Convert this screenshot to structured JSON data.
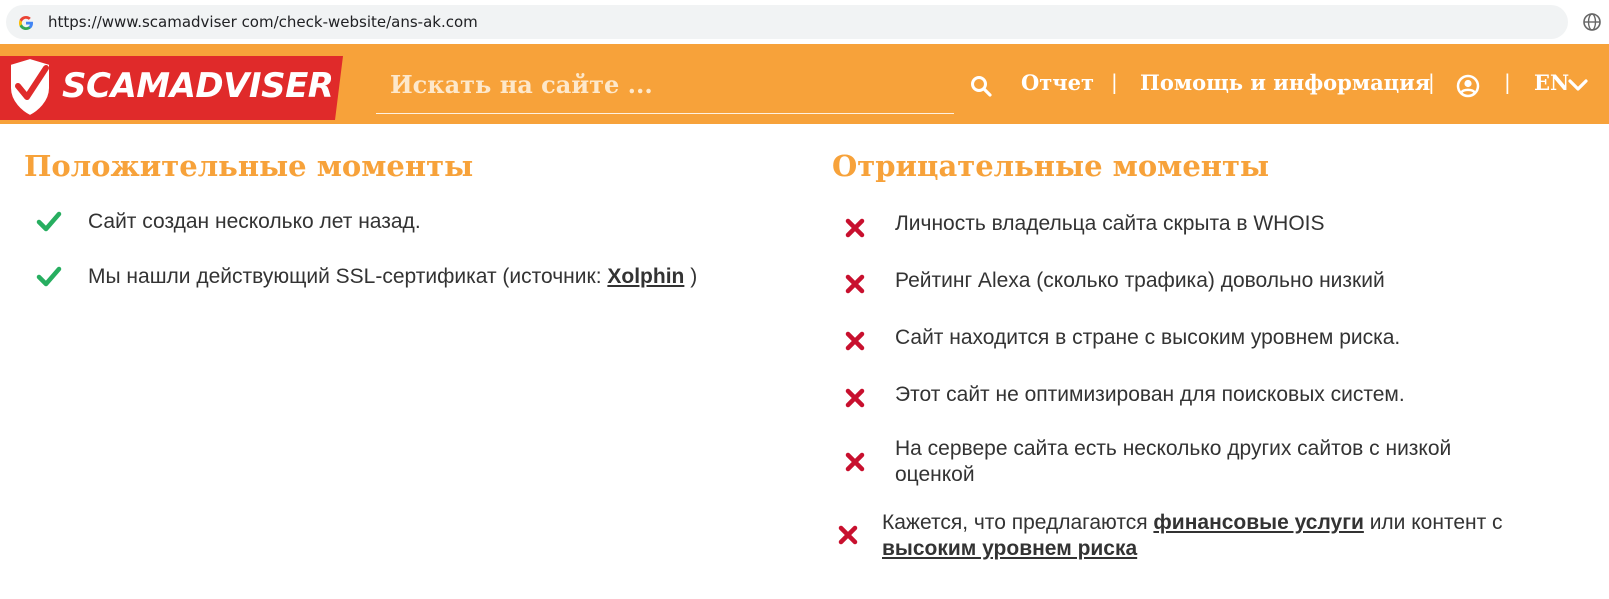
{
  "browser": {
    "url": "https://www.scamadviser com/check-website/ans-ak.com"
  },
  "header": {
    "logo_text": "SCAMADVISER",
    "search_placeholder": "Искать на сайте ...",
    "nav": {
      "report": "Отчет",
      "help": "Помощь и информация",
      "separator": "|",
      "language": "EN"
    },
    "colors": {
      "bar": "#f7a23a",
      "logo_red": "#e02a2a"
    }
  },
  "positives": {
    "title": "Положительные моменты",
    "items": [
      {
        "text": "Сайт создан несколько лет назад."
      },
      {
        "text_before": "Мы нашли действующий SSL-сертификат (источник: ",
        "link": "Xolphin",
        "text_after": " )"
      }
    ],
    "icon": "check-icon",
    "icon_color": "#27ae60"
  },
  "negatives": {
    "title": "Отрицательные моменты",
    "items": [
      {
        "text": "Личность владельца сайта скрыта в WHOIS"
      },
      {
        "text": "Рейтинг Alexa (сколько трафика) довольно низкий"
      },
      {
        "text": "Сайт находится в стране с высоким уровнем риска."
      },
      {
        "text": "Этот сайт не оптимизирован для поисковых систем."
      },
      {
        "text": "На сервере сайта есть несколько других сайтов с низкой оценкой"
      },
      {
        "text_before": "Кажется, что предлагаются ",
        "link1": "финансовые услуги",
        "text_middle": " или контент с ",
        "link2": "высоким уровнем риска"
      }
    ],
    "icon": "x-icon",
    "icon_color": "#c8102e"
  }
}
